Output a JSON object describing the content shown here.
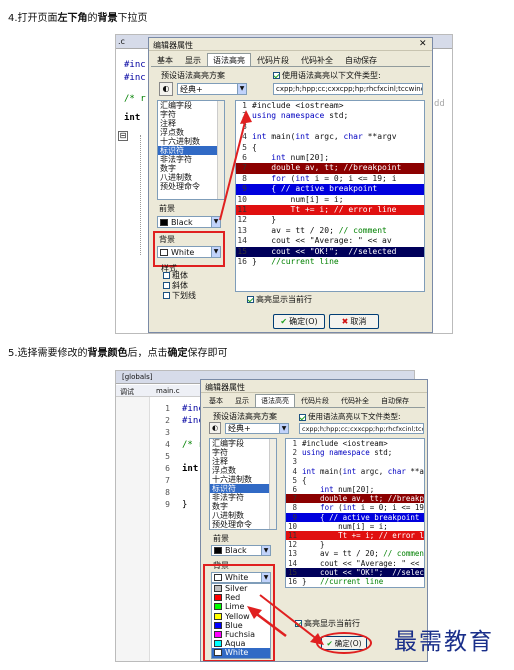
{
  "step4": {
    "prefix": "4.打开页面",
    "bold1": "左下角",
    "mid": "的",
    "bold2": "背景",
    "suffix": "下拉页"
  },
  "step5": {
    "prefix": "5.选择需要修改的",
    "bold1": "背景颜色",
    "mid": "后，点击",
    "bold2": "确定",
    "suffix": "保存即可"
  },
  "dialog": {
    "title": "编辑器属性",
    "tabs": [
      "基本",
      "显示",
      "语法高亮",
      "代码片段",
      "代码补全",
      "自动保存"
    ],
    "scheme_label": "预设语法高亮方案",
    "scheme_value": "经典+",
    "use_hl_label": "使用语法高亮以下文件类型:",
    "file_types": "cxpp;h;hpp;cc;cxxcpp;hp;rhcfxcinl;tccwinc;",
    "file_types_short": "cxpp;h;hpp;cc;cxxcpp;hp;rhcfxcinl;tccwinc;",
    "element_list": [
      "汇编字段",
      "字符",
      "注释",
      "浮点数",
      "十六进制数",
      "标识符",
      "非法字符",
      "数字",
      "八进制数",
      "预处理命令"
    ],
    "selected_element": "标识符",
    "foreground_label": "前景",
    "foreground_value": "Black",
    "background_label": "背景",
    "background_value": "White",
    "style_label": "样式",
    "style_options": [
      "粗体",
      "斜体",
      "下划线"
    ],
    "highlight_line_label": "高亮显示当前行",
    "ok_label": "确定(O)",
    "cancel_label": "取消"
  },
  "code_lines": [
    {
      "n": "1",
      "t": "#include <iostream>"
    },
    {
      "n": "2",
      "t": "using namespace std;"
    },
    {
      "n": "3",
      "t": ""
    },
    {
      "n": "4",
      "t": "int main(int argc, char **argv"
    },
    {
      "n": "5",
      "t": "{"
    },
    {
      "n": "6",
      "t": "    int num[20];"
    },
    {
      "n": "7",
      "t": "    double av, tt; //breakpoint"
    },
    {
      "n": "8",
      "t": "    for (int i = 0; i <= 19; i"
    },
    {
      "n": "9",
      "t": "    { // active breakpoint"
    },
    {
      "n": "10",
      "t": "        num[i] = i;"
    },
    {
      "n": "11",
      "t": "        Tt += i; // error line"
    },
    {
      "n": "12",
      "t": "    }"
    },
    {
      "n": "13",
      "t": "    av = tt / 20; // comment"
    },
    {
      "n": "14",
      "t": "    cout << \"Average: \" << av"
    },
    {
      "n": "15",
      "t": "    cout << \"OK!\";  //selected"
    },
    {
      "n": "16",
      "t": "}   //current line"
    }
  ],
  "ide_top": {
    "lines": [
      "#inc",
      "#inc",
      "/* r",
      "int"
    ],
    "right_text": "dd",
    "file_tab": ".c"
  },
  "ide_bottom": {
    "tab1": "[globals]",
    "tab2": "调试",
    "tab3": "main.c",
    "lines": [
      "#inc",
      "#inc",
      "/* r",
      "int",
      "}"
    ],
    "nums": [
      "1",
      "2",
      "3",
      "4",
      "5",
      "6",
      "7",
      "8",
      "9"
    ]
  },
  "color_options": [
    {
      "name": "Silver",
      "color": "#c0c0c0"
    },
    {
      "name": "Red",
      "color": "#ff0000"
    },
    {
      "name": "Lime",
      "color": "#00ff00"
    },
    {
      "name": "Yellow",
      "color": "#ffff00"
    },
    {
      "name": "Blue",
      "color": "#0000ff"
    },
    {
      "name": "Fuchsia",
      "color": "#ff00ff"
    },
    {
      "name": "Aqua",
      "color": "#00ffff"
    },
    {
      "name": "White",
      "color": "#ffffff"
    }
  ],
  "watermark": "最需教育",
  "colors": {
    "accent": "#e02020",
    "selection": "#316ac5"
  }
}
